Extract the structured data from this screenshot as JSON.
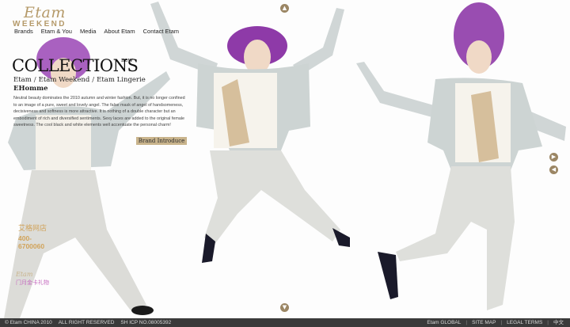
{
  "logo": {
    "script": "Etam",
    "sub": "WEEKEND"
  },
  "nav": {
    "items": [
      {
        "label": "Brands"
      },
      {
        "label": "Etam & You"
      },
      {
        "label": "Media"
      },
      {
        "label": "About Etam"
      },
      {
        "label": "Contact Etam"
      }
    ]
  },
  "collections": {
    "title": "COLLECTIONS",
    "new_tag": "new",
    "links": [
      "Etam",
      "Etam Weekend",
      "Etam Lingerie"
    ],
    "sub_heading": "EHomme",
    "description": "Neutral beauty dominates the 2010 autumn and winter fashion. But, it is no longer confined to an image of a pure, sweet and lovely angel. The false mask of angel of handsomeness, decisiveness and softness is more attractive. It is nothing of a double character but an embodiment of rich and diversified sentiments. Sexy laces are added to the original female sweetness. The cool black and white elements well accentuate the personal charm!",
    "brand_button": "Brand Introduce"
  },
  "online_store": {
    "title": "艾格网店",
    "phone": "400-6700060"
  },
  "etam_small": "Etam",
  "card_link": "门月金卡礼物",
  "arrows": {
    "up": "▲",
    "down": "▼",
    "next": "▶",
    "prev": "◀"
  },
  "footer": {
    "copyright": "© Etam  CHINA 2010",
    "rights": "ALL RIGHT RESERVED",
    "icp": "SH ICP NO.08005392",
    "links": [
      "Etam GLOBAL",
      "SITE MAP",
      "LEGAL TERMS",
      "中文"
    ]
  },
  "colors": {
    "accent": "#b59a6a",
    "button": "#c9b48c",
    "store": "#d1a35a",
    "footer_bg": "#3a3a3a",
    "hair": "#8e3aa8"
  }
}
